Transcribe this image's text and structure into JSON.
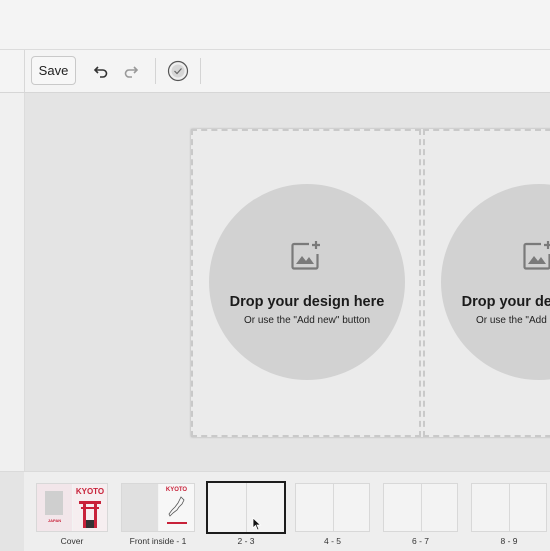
{
  "toolbar": {
    "save_label": "Save",
    "undo_icon": "undo-icon",
    "redo_icon": "redo-icon",
    "check_icon": "check-circle-icon"
  },
  "canvas": {
    "pages": [
      {
        "drop_title": "Drop your design here",
        "drop_subtitle": "Or use the \"Add new\" button"
      },
      {
        "drop_title": "Drop your design here",
        "drop_subtitle": "Or use the \"Add new\" button"
      }
    ]
  },
  "filmstrip": {
    "items": [
      {
        "label": "Cover",
        "art_title": "KYOTO",
        "art_subtitle": "JAPAN"
      },
      {
        "label": "Front inside - 1",
        "art_title": "KYOTO"
      },
      {
        "label": "2 - 3"
      },
      {
        "label": "4 - 5"
      },
      {
        "label": "6 - 7"
      },
      {
        "label": "8 - 9"
      }
    ],
    "active_index": 2
  },
  "colors": {
    "accent_red": "#c8223a",
    "drop_circle": "#d2d2d2",
    "background": "#e6e6e6"
  }
}
